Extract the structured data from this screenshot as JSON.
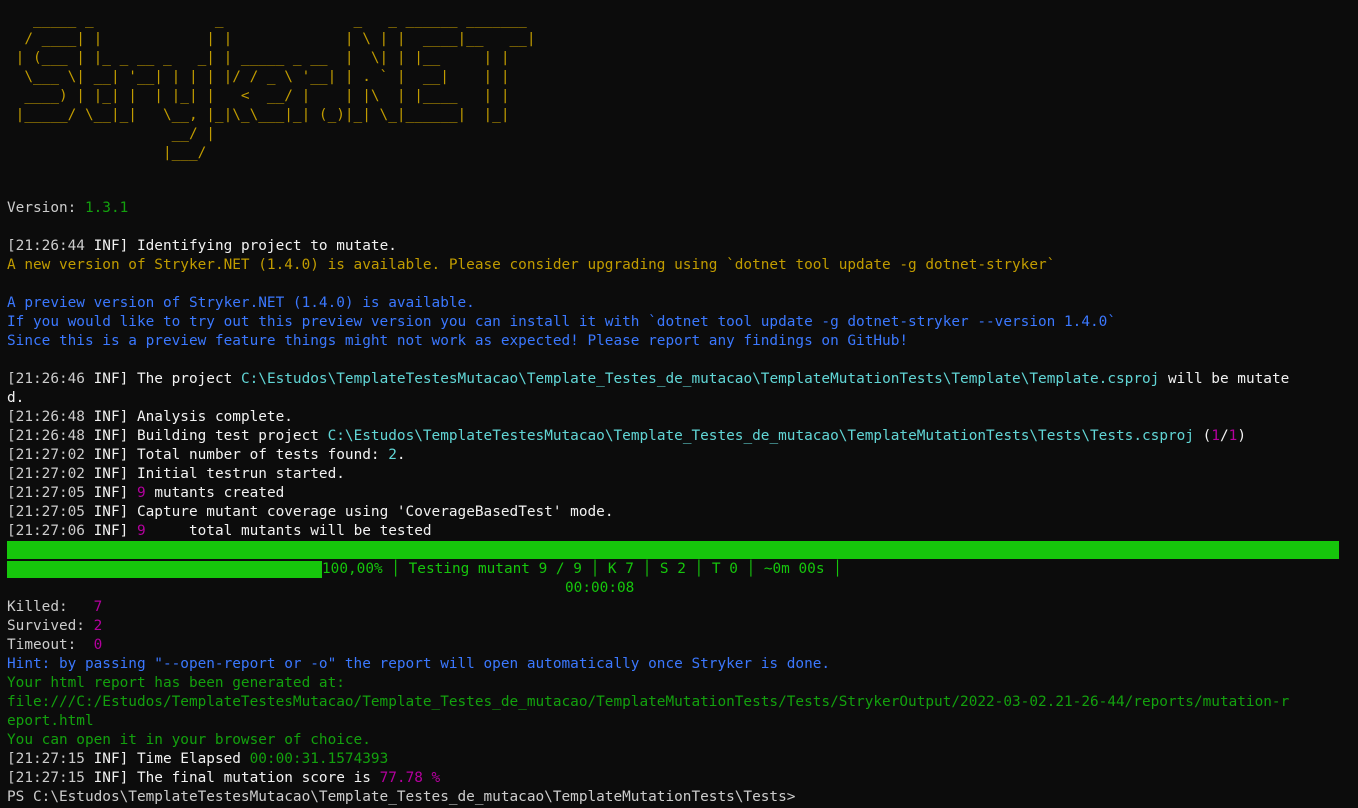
{
  "banner": [
    "   _____ _              _               _   _ ______ _______ ",
    "  / ____| |            | |             | \\ | |  ____|__   __|",
    " | (___ | |_ _ __ _   _| | _____ _ __  |  \\| | |__     | |   ",
    "  \\___ \\| __| '__| | | | |/ / _ \\ '__| | . ` |  __|    | |   ",
    "  ____) | |_| |  | |_| |   <  __/ |    | |\\  | |____   | |   ",
    " |_____/ \\__|_|   \\__, |_|\\_\\___|_| (_)|_| \\_|______|  |_|   ",
    "                   __/ |",
    "                  |___/"
  ],
  "version": {
    "label": "Version: ",
    "value": "1.3.1"
  },
  "log": {
    "ts1": "[21:26:44",
    "inf": " INF]",
    "br": "]",
    "identifying": " Identifying project to mutate.",
    "new_version": "A new version of Stryker.NET (1.4.0) is available. Please consider upgrading using `dotnet tool update -g dotnet-stryker`",
    "preview_1": "A preview version of Stryker.NET (1.4.0) is available.",
    "preview_2": "If you would like to try out this preview version you can install it with `dotnet tool update -g dotnet-stryker --version 1.4.0`",
    "preview_3": "Since this is a preview feature things might not work as expected! Please report any findings on GitHub!",
    "ts2": "[21:26:46",
    "project_prefix": " The project ",
    "project_path": "C:\\Estudos\\TemplateTestesMutacao\\Template_Testes_de_mutacao\\TemplateMutationTests\\Template\\Template.csproj",
    "project_suffix": " will be mutate",
    "project_wrap": "d.",
    "ts3": "[21:26:48",
    "analysis": " Analysis complete.",
    "ts4": "[21:26:48",
    "building_prefix": " Building test project ",
    "building_path": "C:\\Estudos\\TemplateTestesMutacao\\Template_Testes_de_mutacao\\TemplateMutationTests\\Tests\\Tests.csproj",
    "building_open": " (",
    "building_cur": "1",
    "slash": "/",
    "building_total": "1",
    "building_close": ")",
    "ts5": "[21:27:02",
    "tests_found_prefix": " Total number of tests found: ",
    "tests_found_value": "2",
    "dot": ".",
    "ts6": "[21:27:02",
    "initial": " Initial testrun started.",
    "ts7": "[21:27:05",
    "mutants_count": "9",
    "mutants_created": " mutants created",
    "ts8": "[21:27:05",
    "coverage": " Capture mutant coverage using 'CoverageBasedTest' mode.",
    "ts9": "[21:27:06",
    "tested_count": "9",
    "tested_text": "     total mutants will be tested"
  },
  "progress": {
    "fraction": 1.0,
    "text": "100,00% │ Testing mutant 9 / 9 │ K 7 │ S 2 │ T 0 │ ~0m 00s │",
    "elapsed": "00:00:08"
  },
  "summary": {
    "killed_label": "Killed:   ",
    "killed": "7",
    "survived_label": "Survived: ",
    "survived": "2",
    "timeout_label": "Timeout:  ",
    "timeout": "0"
  },
  "report": {
    "hint": "Hint: by passing \"--open-report or -o\" the report will open automatically once Stryker is done.",
    "generated": "Your html report has been generated at:",
    "path_1": "file:///C:/Estudos/TemplateTestesMutacao/Template_Testes_de_mutacao/TemplateMutationTests/Tests/StrykerOutput/2022-03-02.21-26-44/reports/mutation-r",
    "path_2": "eport.html",
    "open": "You can open it in your browser of choice."
  },
  "final": {
    "ts1": "[21:27:15",
    "elapsed_prefix": " Time Elapsed ",
    "elapsed_value": "00:00:31.1574393",
    "ts2": "[21:27:15",
    "score_prefix": " The final mutation score is ",
    "score_value": "77.78 %"
  },
  "prompt": "PS C:\\Estudos\\TemplateTestesMutacao\\Template_Testes_de_mutacao\\TemplateMutationTests\\Tests>",
  "colors": {
    "background": "#0c0c0c",
    "gray": "#cccccc",
    "white": "#f2f2f2",
    "yellow": "#c19c00",
    "green": "#13a10e",
    "bright_green": "#16c60c",
    "blue": "#3b78ff",
    "magenta": "#b4009e",
    "cyan": "#61d6d6"
  }
}
